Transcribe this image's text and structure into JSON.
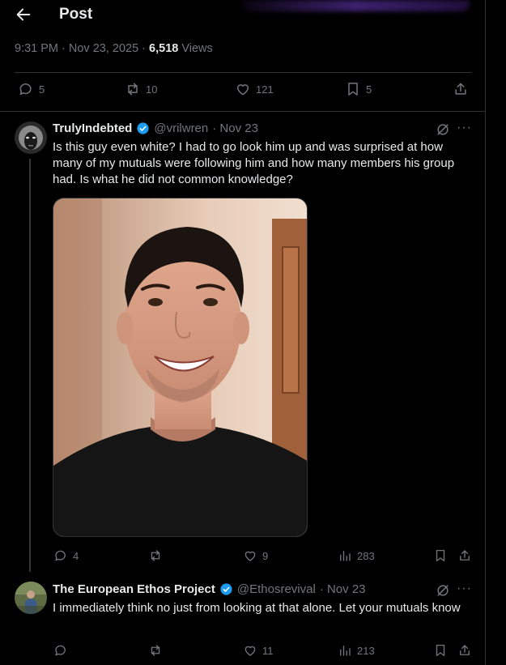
{
  "header": {
    "title": "Post",
    "back_icon": "arrow-left-icon"
  },
  "post_meta": {
    "time": "9:31 PM · Nov 23, 2025 · ",
    "views_count": "6,518",
    "views_label": " Views"
  },
  "main_actions": {
    "replies": "5",
    "reposts": "10",
    "likes": "121",
    "bookmarks": "5"
  },
  "replies": [
    {
      "name": "TrulyIndebted",
      "handle": "@vrilwren",
      "date": "· Nov 23",
      "text": "Is this guy even white? I had to go look him up and was surprised at how many of my mutuals were following him and how many members his group had. Is what he did not common knowledge?",
      "actions": {
        "replies": "4",
        "reposts": "",
        "likes": "9",
        "views": "283"
      }
    },
    {
      "name": "The European Ethos Project",
      "handle": "@Ethosrevival",
      "date": "· Nov 23",
      "text": "I immediately think no just from looking at that alone. Let your mutuals know",
      "actions": {
        "replies": "",
        "reposts": "",
        "likes": "11",
        "views": "213"
      }
    }
  ],
  "colors": {
    "background": "#000000",
    "text": "#e7e9ea",
    "muted": "#71767b",
    "verified": "#1d9bf0",
    "border": "#2f3336"
  }
}
